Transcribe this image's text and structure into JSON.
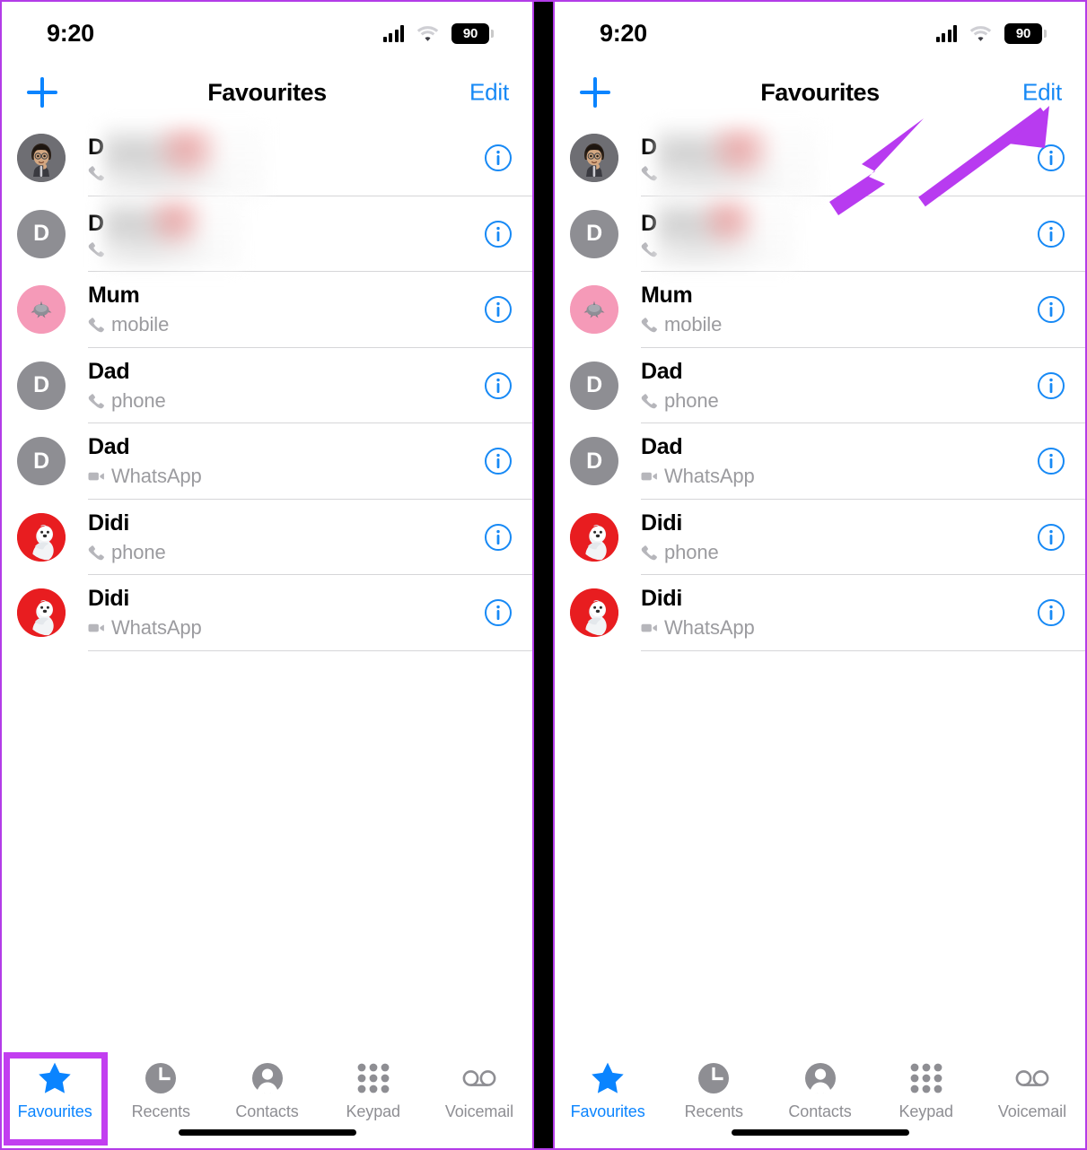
{
  "meta": {
    "app": "Phone",
    "screen": "Favourites",
    "annotation_color": "#c23ef0",
    "accent_color": "#0a84ff"
  },
  "status_bar": {
    "time": "9:20",
    "battery_level": "90",
    "signal_icon": "cellular-bars-icon",
    "wifi_icon": "wifi-icon",
    "battery_icon": "battery-icon"
  },
  "nav_bar": {
    "add_icon": "plus-icon",
    "title": "Favourites",
    "edit_label": "Edit"
  },
  "contacts": [
    {
      "name": "D",
      "redacted": true,
      "subtitle": "",
      "subtitle_icon": "phone-icon",
      "avatar": {
        "type": "memoji",
        "bg": "#6e6e73",
        "initial": ""
      },
      "info_icon": "info-circle-icon"
    },
    {
      "name": "D",
      "redacted": true,
      "subtitle": "",
      "subtitle_icon": "phone-icon",
      "avatar": {
        "type": "initial",
        "bg": "#8e8e93",
        "initial": "D"
      },
      "info_icon": "info-circle-icon"
    },
    {
      "name": "Mum",
      "redacted": false,
      "subtitle": "mobile",
      "subtitle_icon": "phone-icon",
      "avatar": {
        "type": "emoji",
        "bg": "#f59ab8",
        "initial": ""
      },
      "info_icon": "info-circle-icon"
    },
    {
      "name": "Dad",
      "redacted": false,
      "subtitle": "phone",
      "subtitle_icon": "phone-icon",
      "avatar": {
        "type": "initial",
        "bg": "#8e8e93",
        "initial": "D"
      },
      "info_icon": "info-circle-icon"
    },
    {
      "name": "Dad",
      "redacted": false,
      "subtitle": "WhatsApp",
      "subtitle_icon": "video-camera-icon",
      "avatar": {
        "type": "initial",
        "bg": "#8e8e93",
        "initial": "D"
      },
      "info_icon": "info-circle-icon"
    },
    {
      "name": "Didi",
      "redacted": false,
      "subtitle": "phone",
      "subtitle_icon": "phone-icon",
      "avatar": {
        "type": "bear",
        "bg": "#e81d20",
        "initial": ""
      },
      "info_icon": "info-circle-icon"
    },
    {
      "name": "Didi",
      "redacted": false,
      "subtitle": "WhatsApp",
      "subtitle_icon": "video-camera-icon",
      "avatar": {
        "type": "bear",
        "bg": "#e81d20",
        "initial": ""
      },
      "info_icon": "info-circle-icon"
    }
  ],
  "tab_bar": {
    "tabs": [
      {
        "label": "Favourites",
        "icon": "star-icon",
        "active": true
      },
      {
        "label": "Recents",
        "icon": "clock-icon",
        "active": false
      },
      {
        "label": "Contacts",
        "icon": "person-icon",
        "active": false
      },
      {
        "label": "Keypad",
        "icon": "keypad-dots-icon",
        "active": false
      },
      {
        "label": "Voicemail",
        "icon": "voicemail-icon",
        "active": false
      }
    ]
  },
  "annotations": {
    "left_panel": {
      "type": "highlight-box",
      "target": "Favourites tab"
    },
    "right_panel": {
      "type": "arrow",
      "target": "Edit"
    }
  }
}
